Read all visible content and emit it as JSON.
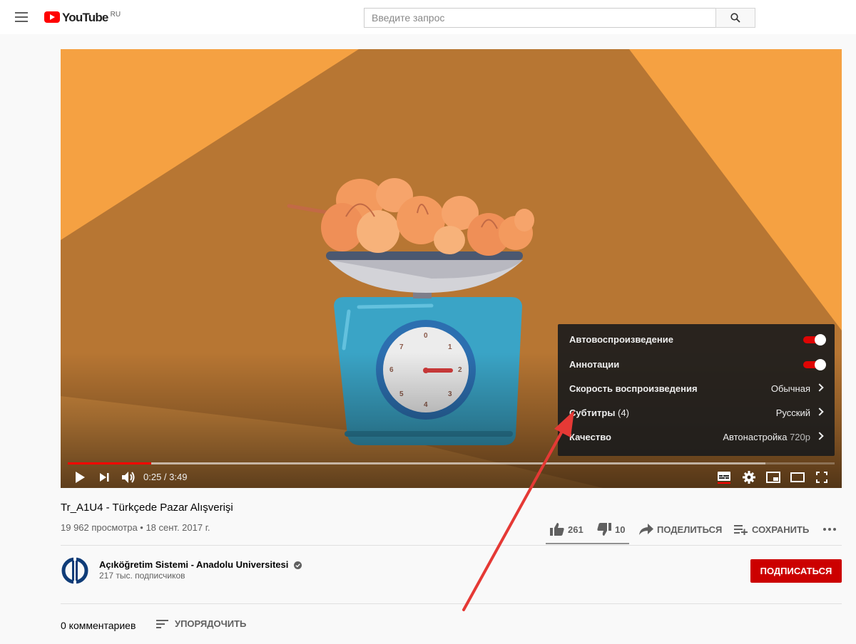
{
  "header": {
    "logo_text": "YouTube",
    "logo_region": "RU",
    "search_placeholder": "Введите запрос",
    "icons": [
      "menu-icon",
      "search-icon"
    ]
  },
  "player": {
    "progress_fraction": 0.109,
    "buffered_fraction": 0.91,
    "time_current": "0:25",
    "time_total": "3:49",
    "time_display": "0:25 / 3:49",
    "icons": [
      "play-icon",
      "next-icon",
      "volume-icon",
      "subtitles-icon",
      "settings-icon",
      "miniplayer-icon",
      "theater-icon",
      "fullscreen-icon"
    ],
    "settings_menu": {
      "autoplay_label": "Автовоспроизведение",
      "autoplay_on": true,
      "annotations_label": "Аннотации",
      "annotations_on": true,
      "speed_label": "Скорость воспроизведения",
      "speed_value": "Обычная",
      "subtitles_label": "Субтитры",
      "subtitles_count": "(4)",
      "subtitles_value": "Русский",
      "quality_label": "Качество",
      "quality_value": "Автонастройка",
      "quality_detail": "720p"
    },
    "scale_dial_numbers": [
      "0",
      "1",
      "2",
      "3",
      "4",
      "5",
      "6",
      "7"
    ]
  },
  "video": {
    "title": "Tr_A1U4 - Türkçede Pazar Alışverişi",
    "meta": "19 962 просмотра • 18 сент. 2017 г.",
    "likes": "261",
    "dislikes": "10",
    "like_fraction": 0.963,
    "share_label": "ПОДЕЛИТЬСЯ",
    "save_label": "СОХРАНИТЬ"
  },
  "channel": {
    "name": "Açıköğretim Sistemi - Anadolu Universitesi",
    "subscribers": "217 тыс. подписчиков",
    "subscribe_label": "ПОДПИСАТЬСЯ"
  },
  "comments": {
    "count_label": "0 комментариев",
    "sort_label": "УПОРЯДОЧИТЬ"
  },
  "colors": {
    "brand_red": "#ff0000",
    "subscribe_red": "#cc0000",
    "video_background": "#b77633",
    "video_light": "#f5a142",
    "arrow": "#e53935"
  }
}
